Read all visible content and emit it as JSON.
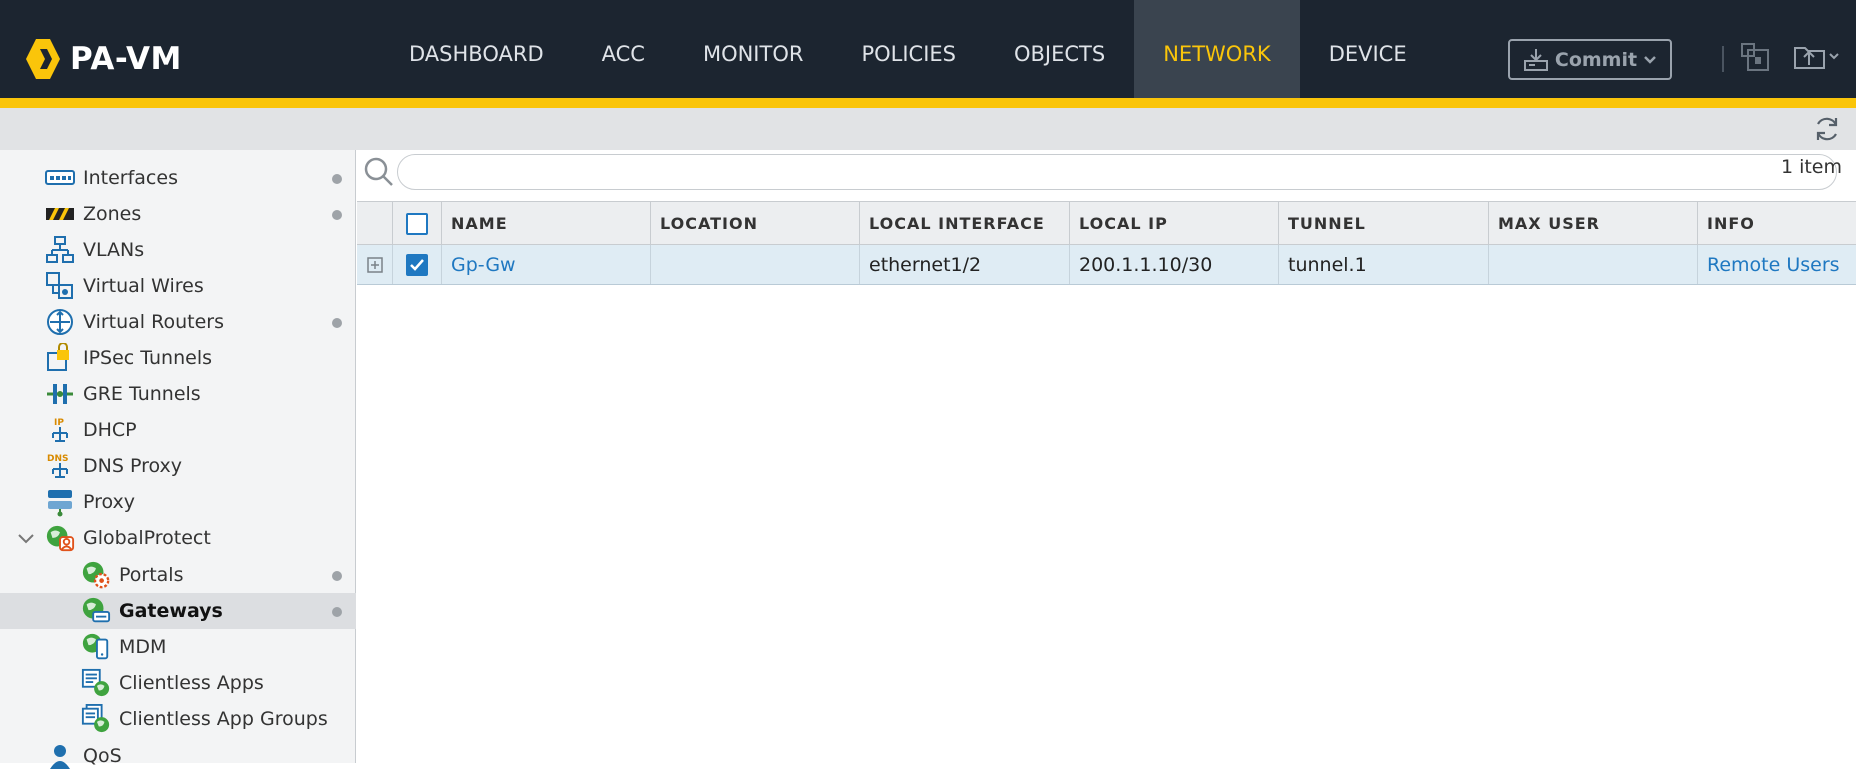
{
  "brand": {
    "name": "PA-VM",
    "accent": "#fac50a"
  },
  "nav": {
    "items": [
      {
        "label": "DASHBOARD"
      },
      {
        "label": "ACC"
      },
      {
        "label": "MONITOR"
      },
      {
        "label": "POLICIES"
      },
      {
        "label": "OBJECTS"
      },
      {
        "label": "NETWORK",
        "active": true
      },
      {
        "label": "DEVICE"
      }
    ],
    "commit_label": "Commit"
  },
  "sidebar": {
    "items": [
      {
        "label": "Interfaces",
        "icon": "interfaces-icon",
        "dot": true
      },
      {
        "label": "Zones",
        "icon": "zones-icon",
        "dot": true
      },
      {
        "label": "VLANs",
        "icon": "vlans-icon"
      },
      {
        "label": "Virtual Wires",
        "icon": "virtual-wires-icon"
      },
      {
        "label": "Virtual Routers",
        "icon": "virtual-routers-icon",
        "dot": true
      },
      {
        "label": "IPSec Tunnels",
        "icon": "ipsec-tunnels-icon"
      },
      {
        "label": "GRE Tunnels",
        "icon": "gre-tunnels-icon"
      },
      {
        "label": "DHCP",
        "icon": "dhcp-icon"
      },
      {
        "label": "DNS Proxy",
        "icon": "dns-proxy-icon"
      },
      {
        "label": "Proxy",
        "icon": "proxy-icon"
      },
      {
        "label": "GlobalProtect",
        "icon": "globalprotect-icon",
        "expanded": true
      },
      {
        "label": "Portals",
        "icon": "portals-icon",
        "dot": true
      },
      {
        "label": "Gateways",
        "icon": "gateways-icon",
        "dot": true,
        "selected": true
      },
      {
        "label": "MDM",
        "icon": "mdm-icon"
      },
      {
        "label": "Clientless Apps",
        "icon": "clientless-apps-icon"
      },
      {
        "label": "Clientless App Groups",
        "icon": "clientless-app-groups-icon"
      },
      {
        "label": "QoS",
        "icon": "qos-icon"
      }
    ]
  },
  "search": {
    "placeholder": "",
    "count": "1 item"
  },
  "table": {
    "columns": [
      "NAME",
      "LOCATION",
      "LOCAL INTERFACE",
      "LOCAL IP",
      "TUNNEL",
      "MAX USER",
      "INFO"
    ],
    "rows": [
      {
        "name": "Gp-Gw",
        "location": "",
        "local_interface": "ethernet1/2",
        "local_ip": "200.1.1.10/30",
        "tunnel": "tunnel.1",
        "max_user": "",
        "info": "Remote Users",
        "checked": true
      }
    ]
  }
}
